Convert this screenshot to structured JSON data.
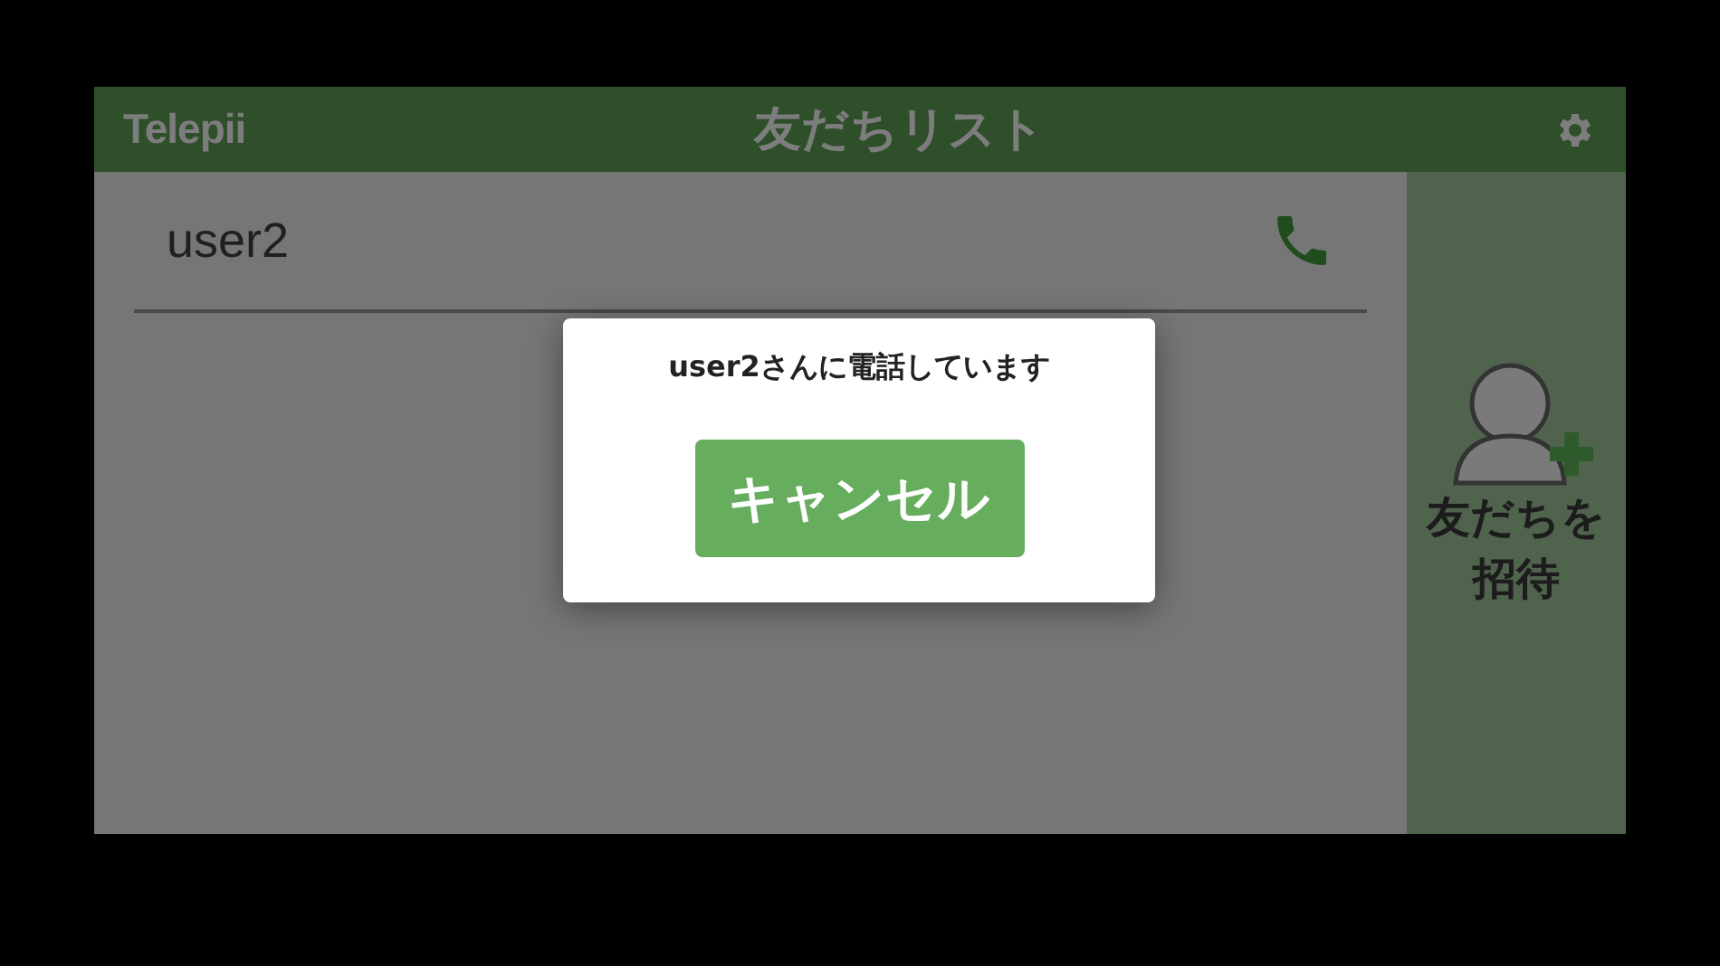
{
  "header": {
    "logo": "Telepii",
    "title": "友だちリスト"
  },
  "friends": [
    {
      "name": "user2"
    }
  ],
  "sidebar": {
    "invite_label": "友だちを招待"
  },
  "dialog": {
    "message": "user2さんに電話しています",
    "button": "キャンセル"
  }
}
